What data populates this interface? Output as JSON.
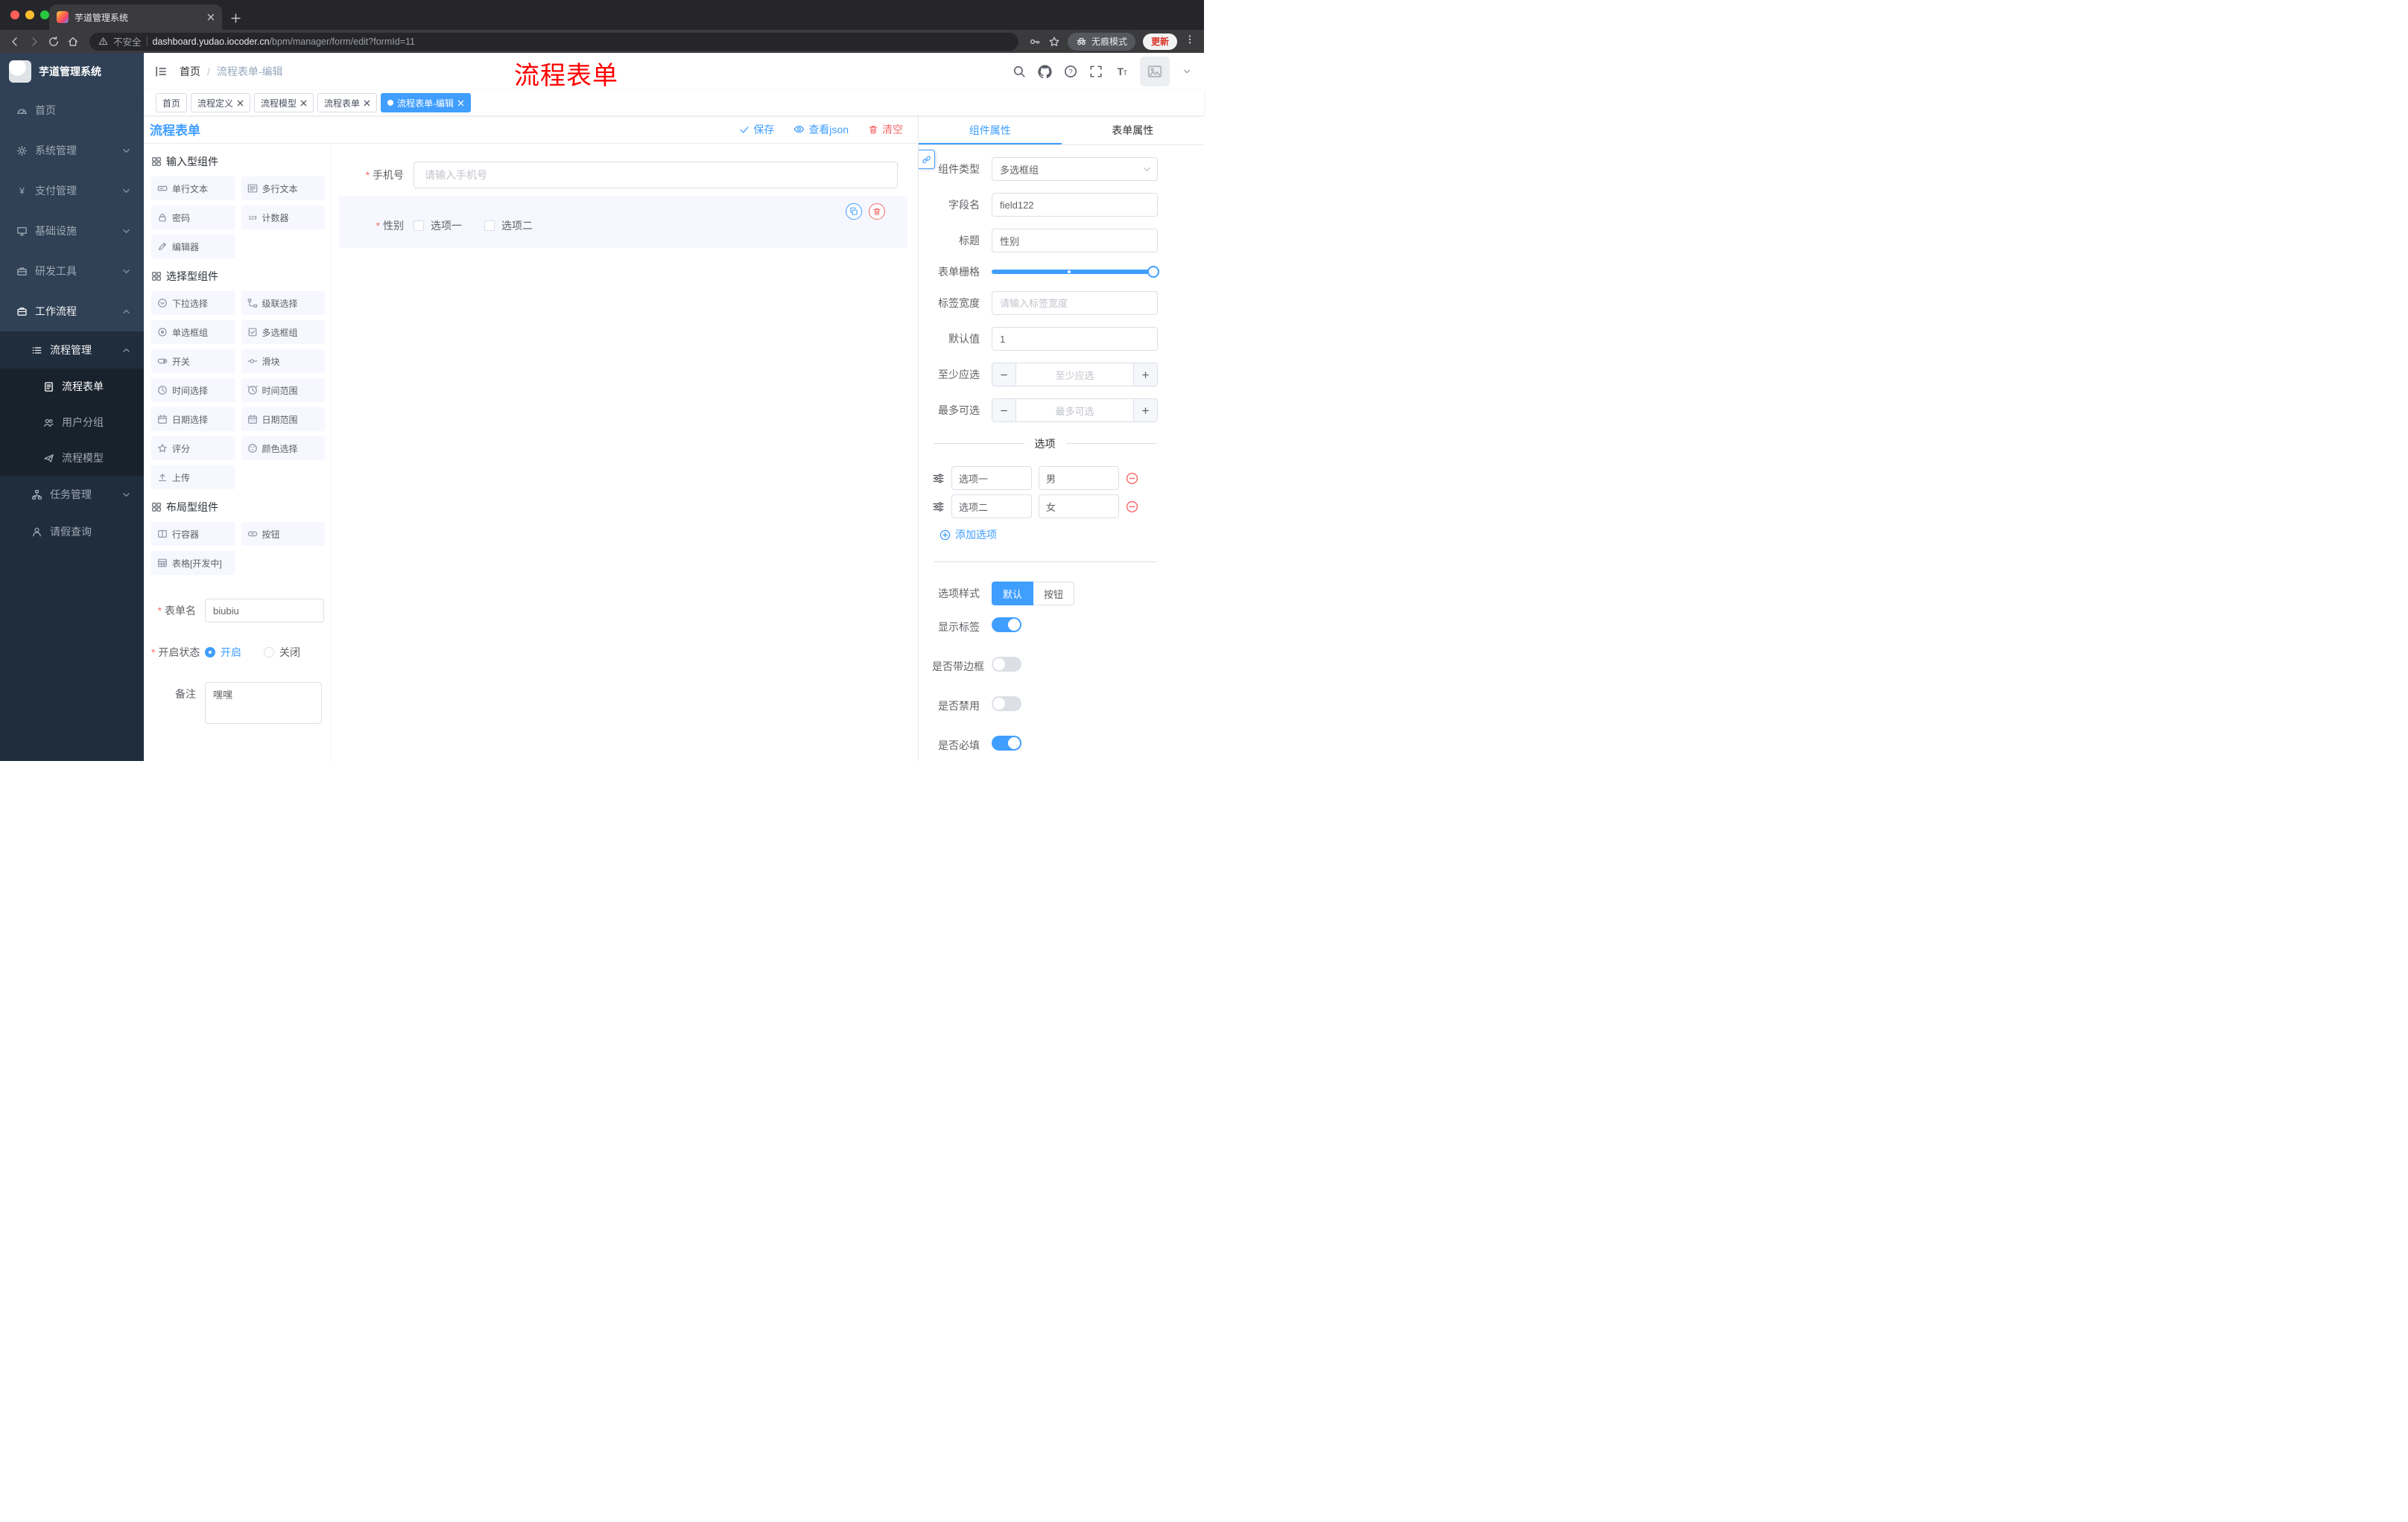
{
  "browser": {
    "tab_title": "芋道管理系统",
    "security_label": "不安全",
    "url_host": "dashboard.yudao.iocoder.cn",
    "url_path": "/bpm/manager/form/edit?formId=11",
    "incognito_label": "无痕模式",
    "update_label": "更新"
  },
  "sidebar": {
    "app_title": "芋道管理系统",
    "menu": [
      {
        "label": "首页",
        "icon": "dashboard-icon"
      },
      {
        "label": "系统管理",
        "icon": "gear-icon"
      },
      {
        "label": "支付管理",
        "icon": "yen-icon"
      },
      {
        "label": "基础设施",
        "icon": "monitor-icon"
      },
      {
        "label": "研发工具",
        "icon": "toolbox-icon"
      },
      {
        "label": "工作流程",
        "icon": "briefcase-icon",
        "expanded": true
      }
    ],
    "workflow": {
      "process_mgmt": {
        "label": "流程管理",
        "icon": "list-icon",
        "expanded": true
      },
      "process_form": {
        "label": "流程表单",
        "icon": "document-icon",
        "active": true
      },
      "user_group": {
        "label": "用户分组",
        "icon": "users-icon"
      },
      "process_model": {
        "label": "流程模型",
        "icon": "send-icon"
      },
      "task_mgmt": {
        "label": "任务管理",
        "icon": "tree-icon"
      },
      "leave_query": {
        "label": "请假查询",
        "icon": "user-icon"
      }
    }
  },
  "header": {
    "breadcrumb": {
      "home": "首页",
      "separator": "/",
      "current": "流程表单-编辑"
    },
    "annotation": "流程表单"
  },
  "tags": [
    {
      "label": "首页",
      "closable": false,
      "active": false
    },
    {
      "label": "流程定义",
      "closable": true,
      "active": false
    },
    {
      "label": "流程模型",
      "closable": true,
      "active": false
    },
    {
      "label": "流程表单",
      "closable": true,
      "active": false
    },
    {
      "label": "流程表单-编辑",
      "closable": true,
      "active": true
    }
  ],
  "designer": {
    "title": "流程表单",
    "actions": {
      "save": "保存",
      "view_json": "查看json",
      "clear": "清空"
    },
    "palette": {
      "sections": [
        {
          "title": "输入型组件",
          "items": [
            {
              "label": "单行文本",
              "icon": "single-line-text-icon"
            },
            {
              "label": "多行文本",
              "icon": "multi-line-text-icon"
            },
            {
              "label": "密码",
              "icon": "lock-icon"
            },
            {
              "label": "计数器",
              "icon": "counter-icon"
            },
            {
              "label": "编辑器",
              "icon": "editor-icon"
            }
          ]
        },
        {
          "title": "选择型组件",
          "items": [
            {
              "label": "下拉选择",
              "icon": "select-icon"
            },
            {
              "label": "级联选择",
              "icon": "cascader-icon"
            },
            {
              "label": "单选框组",
              "icon": "radio-group-icon"
            },
            {
              "label": "多选框组",
              "icon": "checkbox-group-icon"
            },
            {
              "label": "开关",
              "icon": "switch-icon"
            },
            {
              "label": "滑块",
              "icon": "slider-icon"
            },
            {
              "label": "时间选择",
              "icon": "time-picker-icon"
            },
            {
              "label": "时间范围",
              "icon": "time-range-icon"
            },
            {
              "label": "日期选择",
              "icon": "date-picker-icon"
            },
            {
              "label": "日期范围",
              "icon": "date-range-icon"
            },
            {
              "label": "评分",
              "icon": "rate-icon"
            },
            {
              "label": "颜色选择",
              "icon": "color-picker-icon"
            },
            {
              "label": "上传",
              "icon": "upload-icon"
            }
          ]
        },
        {
          "title": "布局型组件",
          "items": [
            {
              "label": "行容器",
              "icon": "row-container-icon"
            },
            {
              "label": "按钮",
              "icon": "button-icon"
            },
            {
              "label": "表格[开发中]",
              "icon": "table-icon"
            }
          ]
        }
      ]
    },
    "meta": {
      "form_name_label": "表单名",
      "form_name_value": "biubiu",
      "status_label": "开启状态",
      "status_on": "开启",
      "status_off": "关闭",
      "remark_label": "备注",
      "remark_value": "嘿嘿"
    },
    "canvas": {
      "phone_label": "手机号",
      "phone_placeholder": "请输入手机号",
      "gender_label": "性别",
      "gender_option1": "选项一",
      "gender_option2": "选项二"
    }
  },
  "props": {
    "tabs": {
      "component": "组件属性",
      "form": "表单属性"
    },
    "component_type": {
      "label": "组件类型",
      "value": "多选框组"
    },
    "field_name": {
      "label": "字段名",
      "value": "field122"
    },
    "title": {
      "label": "标题",
      "value": "性别"
    },
    "grid": {
      "label": "表单栅格"
    },
    "label_width": {
      "label": "标签宽度",
      "placeholder": "请输入标签宽度"
    },
    "default_value": {
      "label": "默认值",
      "value": "1"
    },
    "min_select": {
      "label": "至少应选",
      "placeholder": "至少应选"
    },
    "max_select": {
      "label": "最多可选",
      "placeholder": "最多可选"
    },
    "options_divider": "选项",
    "options": [
      {
        "name": "选项一",
        "value": "男"
      },
      {
        "name": "选项二",
        "value": "女"
      }
    ],
    "add_option": "添加选项",
    "option_style": {
      "label": "选项样式",
      "default": "默认",
      "button": "按钮"
    },
    "switches": [
      {
        "label": "显示标签",
        "on": true
      },
      {
        "label": "是否带边框",
        "on": false
      },
      {
        "label": "是否禁用",
        "on": false
      },
      {
        "label": "是否必填",
        "on": true
      }
    ]
  },
  "colors": {
    "primary": "#409EFF",
    "danger": "#F56C6C",
    "sidebar": "#304156",
    "annotation": "#FF0000"
  }
}
